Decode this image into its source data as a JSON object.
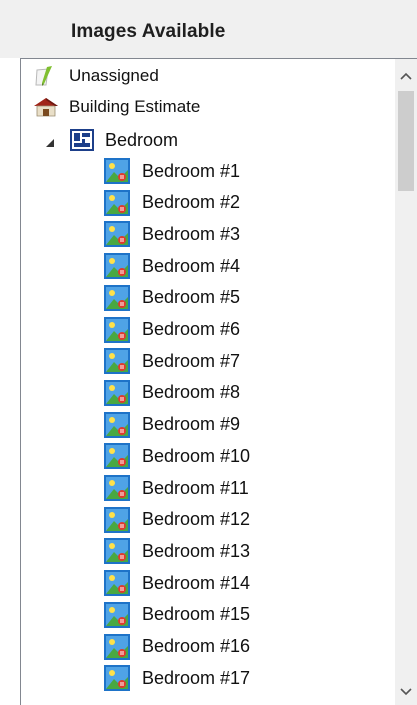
{
  "header": {
    "title": "Images Available"
  },
  "tree": {
    "top_items": [
      {
        "label": "Unassigned",
        "icon": "note-pencil-icon"
      },
      {
        "label": "Building Estimate",
        "icon": "house-icon"
      }
    ],
    "group": {
      "label": "Bedroom",
      "icon": "floor-plan-icon",
      "expanded": true
    },
    "children": [
      "Bedroom #1",
      "Bedroom #2",
      "Bedroom #3",
      "Bedroom #4",
      "Bedroom #5",
      "Bedroom #6",
      "Bedroom #7",
      "Bedroom #8",
      "Bedroom #9",
      "Bedroom #10",
      "Bedroom #11",
      "Bedroom #12",
      "Bedroom #13",
      "Bedroom #14",
      "Bedroom #15",
      "Bedroom #16",
      "Bedroom #17"
    ],
    "child_icon": "image-icon"
  },
  "colors": {
    "header_bg": "#f0f0f0",
    "accent_blue": "#1e73c8",
    "border": "#828790"
  }
}
